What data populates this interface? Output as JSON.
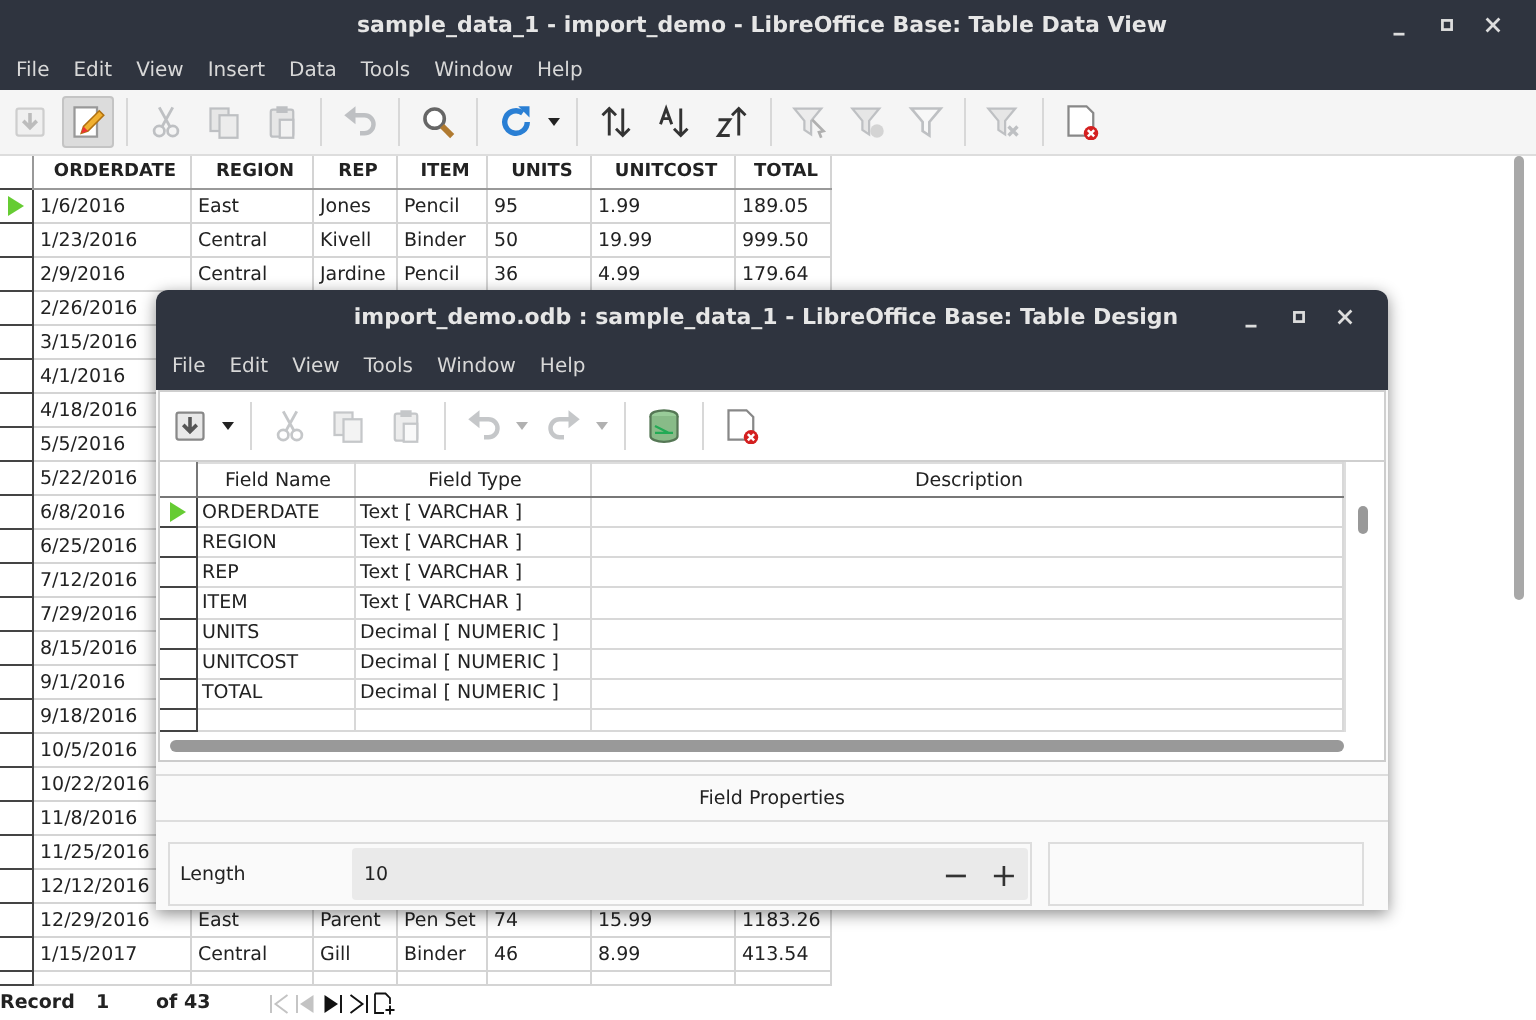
{
  "main_window": {
    "title": "sample_data_1 - import_demo - LibreOffice Base: Table Data View",
    "menu": [
      "File",
      "Edit",
      "View",
      "Insert",
      "Data",
      "Tools",
      "Window",
      "Help"
    ],
    "toolbar": [
      {
        "kind": "save",
        "disabled": true,
        "pressed": false
      },
      {
        "kind": "edit",
        "disabled": false,
        "pressed": true
      },
      {
        "kind": "separator"
      },
      {
        "kind": "cut",
        "disabled": true,
        "pressed": false
      },
      {
        "kind": "copy",
        "disabled": true,
        "pressed": false
      },
      {
        "kind": "paste",
        "disabled": true,
        "pressed": false
      },
      {
        "kind": "separator"
      },
      {
        "kind": "undo",
        "disabled": true,
        "pressed": false
      },
      {
        "kind": "separator"
      },
      {
        "kind": "find",
        "disabled": false,
        "pressed": false
      },
      {
        "kind": "separator"
      },
      {
        "kind": "refresh",
        "disabled": false,
        "pressed": false,
        "dropdown": true
      },
      {
        "kind": "separator"
      },
      {
        "kind": "sort",
        "disabled": false,
        "pressed": false
      },
      {
        "kind": "sort_asc",
        "disabled": false,
        "pressed": false
      },
      {
        "kind": "sort_desc",
        "disabled": false,
        "pressed": false
      },
      {
        "kind": "separator"
      },
      {
        "kind": "autofilter",
        "disabled": true,
        "pressed": false
      },
      {
        "kind": "standard_filter",
        "disabled": true,
        "pressed": false
      },
      {
        "kind": "filter",
        "disabled": true,
        "pressed": false
      },
      {
        "kind": "separator"
      },
      {
        "kind": "remove_filter",
        "disabled": true,
        "pressed": false
      },
      {
        "kind": "separator"
      },
      {
        "kind": "close",
        "disabled": false,
        "pressed": false
      }
    ],
    "table": {
      "columns": [
        "ORDERDATE",
        "REGION",
        "REP",
        "ITEM",
        "UNITS",
        "UNITCOST",
        "TOTAL"
      ],
      "rows": [
        {
          "current": true,
          "cells": [
            "1/6/2016",
            "East",
            "Jones",
            "Pencil",
            "95",
            "1.99",
            "189.05"
          ]
        },
        {
          "current": false,
          "cells": [
            "1/23/2016",
            "Central",
            "Kivell",
            "Binder",
            "50",
            "19.99",
            "999.50"
          ]
        },
        {
          "current": false,
          "cells": [
            "2/9/2016",
            "Central",
            "Jardine",
            "Pencil",
            "36",
            "4.99",
            "179.64"
          ]
        },
        {
          "current": false,
          "cells": [
            "2/26/2016"
          ]
        },
        {
          "current": false,
          "cells": [
            "3/15/2016"
          ]
        },
        {
          "current": false,
          "cells": [
            "4/1/2016"
          ]
        },
        {
          "current": false,
          "cells": [
            "4/18/2016"
          ]
        },
        {
          "current": false,
          "cells": [
            "5/5/2016"
          ]
        },
        {
          "current": false,
          "cells": [
            "5/22/2016"
          ]
        },
        {
          "current": false,
          "cells": [
            "6/8/2016"
          ]
        },
        {
          "current": false,
          "cells": [
            "6/25/2016"
          ]
        },
        {
          "current": false,
          "cells": [
            "7/12/2016"
          ]
        },
        {
          "current": false,
          "cells": [
            "7/29/2016"
          ]
        },
        {
          "current": false,
          "cells": [
            "8/15/2016"
          ]
        },
        {
          "current": false,
          "cells": [
            "9/1/2016"
          ]
        },
        {
          "current": false,
          "cells": [
            "9/18/2016"
          ]
        },
        {
          "current": false,
          "cells": [
            "10/5/2016"
          ]
        },
        {
          "current": false,
          "cells": [
            "10/22/2016"
          ]
        },
        {
          "current": false,
          "cells": [
            "11/8/2016"
          ]
        },
        {
          "current": false,
          "cells": [
            "11/25/2016"
          ]
        },
        {
          "current": false,
          "cells": [
            "12/12/2016"
          ]
        },
        {
          "current": false,
          "cells": [
            "12/29/2016",
            "East",
            "Parent",
            "Pen Set",
            "74",
            "15.99",
            "1183.26"
          ]
        },
        {
          "current": false,
          "cells": [
            "1/15/2017",
            "Central",
            "Gill",
            "Binder",
            "46",
            "8.99",
            "413.54"
          ]
        }
      ]
    },
    "record_bar": {
      "label": "Record",
      "value": "1",
      "total": "of 43",
      "nav": [
        {
          "kind": "first",
          "disabled": true
        },
        {
          "kind": "prev",
          "disabled": true
        },
        {
          "kind": "next",
          "disabled": false
        },
        {
          "kind": "last",
          "disabled": false
        },
        {
          "kind": "new",
          "disabled": false
        }
      ]
    }
  },
  "dialog": {
    "title": "import_demo.odb : sample_data_1 - LibreOffice Base: Table Design",
    "menu": [
      "File",
      "Edit",
      "View",
      "Tools",
      "Window",
      "Help"
    ],
    "toolbar": [
      {
        "kind": "save",
        "disabled": false,
        "pressed": false,
        "dropdown": true
      },
      {
        "kind": "separator"
      },
      {
        "kind": "cut",
        "disabled": true,
        "pressed": false
      },
      {
        "kind": "copy",
        "disabled": true,
        "pressed": false
      },
      {
        "kind": "paste",
        "disabled": true,
        "pressed": false
      },
      {
        "kind": "separator"
      },
      {
        "kind": "undo",
        "disabled": true,
        "pressed": false,
        "dropdown": true
      },
      {
        "kind": "redo",
        "disabled": true,
        "pressed": false,
        "dropdown": true
      },
      {
        "kind": "separator"
      },
      {
        "kind": "database",
        "disabled": false,
        "pressed": false
      },
      {
        "kind": "separator"
      },
      {
        "kind": "close",
        "disabled": false,
        "pressed": false
      }
    ],
    "table": {
      "columns": [
        "Field Name",
        "Field Type",
        "Description"
      ],
      "rows": [
        {
          "current": true,
          "name": "ORDERDATE",
          "type": "Text [ VARCHAR ]"
        },
        {
          "current": false,
          "name": "REGION",
          "type": "Text [ VARCHAR ]"
        },
        {
          "current": false,
          "name": "REP",
          "type": "Text [ VARCHAR ]"
        },
        {
          "current": false,
          "name": "ITEM",
          "type": "Text [ VARCHAR ]"
        },
        {
          "current": false,
          "name": "UNITS",
          "type": "Decimal [ NUMERIC ]"
        },
        {
          "current": false,
          "name": "UNITCOST",
          "type": "Decimal [ NUMERIC ]"
        },
        {
          "current": false,
          "name": "TOTAL",
          "type": "Decimal [ NUMERIC ]"
        }
      ]
    },
    "field_properties": {
      "title": "Field Properties",
      "label": "Length",
      "value": "10",
      "decrement": "−",
      "increment": "+"
    }
  }
}
